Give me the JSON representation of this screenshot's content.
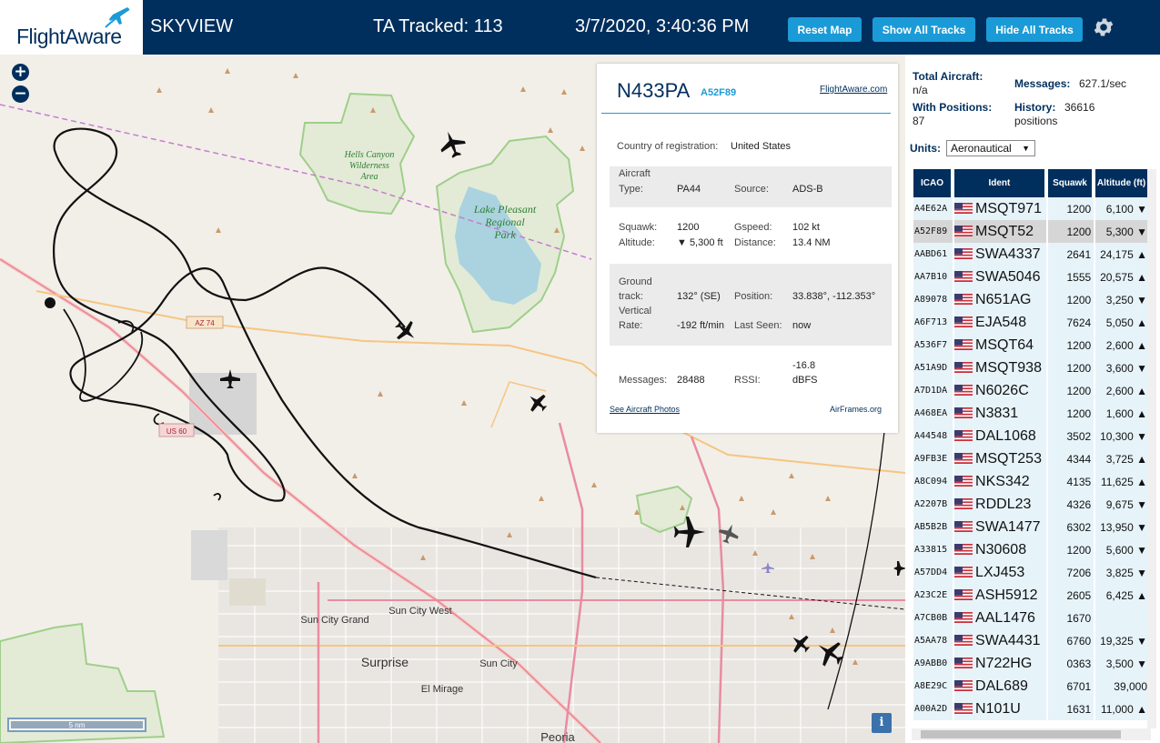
{
  "header": {
    "logo_text": "FlightAware",
    "app_name": "SKYVIEW",
    "ta_tracked": "TA Tracked: 113",
    "datetime": "3/7/2020, 3:40:36 PM",
    "buttons": {
      "reset_map": "Reset Map",
      "show_all_tracks": "Show All Tracks",
      "hide_all_tracks": "Hide All Tracks"
    },
    "settings_icon": "gear-icon"
  },
  "map": {
    "zoom_in": "+",
    "zoom_out": "−",
    "scale_label": "5 nm",
    "info_label": "i",
    "labels": {
      "hells_canyon": [
        "Hells Canyon",
        "Wilderness",
        "Area"
      ],
      "lake_pleasant": [
        "Lake Pleasant",
        "Regional",
        "Park"
      ],
      "sun_city_grand": "Sun City Grand",
      "sun_city_west": "Sun City West",
      "surprise": "Surprise",
      "sun_city": "Sun City",
      "el_mirage": "El Mirage",
      "peoria": "Peoria",
      "hwy_74": "AZ 74",
      "hwy_60": "US 60"
    }
  },
  "popup": {
    "ident": "N433PA",
    "hex": "A52F89",
    "flightaware_link": "FlightAware.com",
    "country_label": "Country of registration:",
    "country_value": "United States",
    "aircraft_type_label_1": "Aircraft",
    "aircraft_type_label_2": "Type:",
    "aircraft_type_value": "PA44",
    "source_label": "Source:",
    "source_value": "ADS-B",
    "squawk_label": "Squawk:",
    "squawk_value": "1200",
    "gspeed_label": "Gspeed:",
    "gspeed_value": "102 kt",
    "altitude_label": "Altitude:",
    "altitude_value": "▼ 5,300 ft",
    "distance_label": "Distance:",
    "distance_value": "13.4 NM",
    "ground_track_label_1": "Ground",
    "ground_track_label_2": "track:",
    "ground_track_value": "132° (SE)",
    "position_label": "Position:",
    "position_value": "33.838°, -112.353°",
    "vertical_rate_label_1": "Vertical",
    "vertical_rate_label_2": "Rate:",
    "vertical_rate_value": "-192 ft/min",
    "last_seen_label": "Last Seen:",
    "last_seen_value": "now",
    "messages_label": "Messages:",
    "messages_value": "28488",
    "rssi_label": "RSSI:",
    "rssi_value_1": "-16.8",
    "rssi_value_2": "dBFS",
    "photos_link": "See Aircraft Photos",
    "airframes_link": "AirFrames.org"
  },
  "sidebar": {
    "total_aircraft_label": "Total Aircraft:",
    "total_aircraft_value": "n/a",
    "messages_label": "Messages:",
    "messages_value": "627.1/sec",
    "with_positions_label": "With Positions:",
    "with_positions_value": "87",
    "history_label": "History:",
    "history_value_1": "36616",
    "history_value_2": "positions",
    "units_label": "Units:",
    "units_value": "Aeronautical",
    "columns": [
      "ICAO",
      "Ident",
      "Squawk",
      "Altitude (ft)"
    ],
    "rows": [
      {
        "icao": "A4E62A",
        "ident": "MSQT971",
        "squawk": "1200",
        "alt": "6,100 ▼",
        "selected": false
      },
      {
        "icao": "A52F89",
        "ident": "MSQT52",
        "squawk": "1200",
        "alt": "5,300 ▼",
        "selected": true
      },
      {
        "icao": "AABD61",
        "ident": "SWA4337",
        "squawk": "2641",
        "alt": "24,175 ▲",
        "selected": false
      },
      {
        "icao": "AA7B10",
        "ident": "SWA5046",
        "squawk": "1555",
        "alt": "20,575 ▲",
        "selected": false
      },
      {
        "icao": "A89078",
        "ident": "N651AG",
        "squawk": "1200",
        "alt": "3,250 ▼",
        "selected": false
      },
      {
        "icao": "A6F713",
        "ident": "EJA548",
        "squawk": "7624",
        "alt": "5,050 ▲",
        "selected": false
      },
      {
        "icao": "A536F7",
        "ident": "MSQT64",
        "squawk": "1200",
        "alt": "2,600 ▲",
        "selected": false
      },
      {
        "icao": "A51A9D",
        "ident": "MSQT938",
        "squawk": "1200",
        "alt": "3,600 ▼",
        "selected": false
      },
      {
        "icao": "A7D1DA",
        "ident": "N6026C",
        "squawk": "1200",
        "alt": "2,600 ▲",
        "selected": false
      },
      {
        "icao": "A468EA",
        "ident": "N3831",
        "squawk": "1200",
        "alt": "1,600 ▲",
        "selected": false
      },
      {
        "icao": "A44548",
        "ident": "DAL1068",
        "squawk": "3502",
        "alt": "10,300 ▼",
        "selected": false
      },
      {
        "icao": "A9FB3E",
        "ident": "MSQT253",
        "squawk": "4344",
        "alt": "3,725 ▲",
        "selected": false
      },
      {
        "icao": "A8C094",
        "ident": "NKS342",
        "squawk": "4135",
        "alt": "11,625 ▲",
        "selected": false
      },
      {
        "icao": "A2207B",
        "ident": "RDDL23",
        "squawk": "4326",
        "alt": "9,675 ▼",
        "selected": false
      },
      {
        "icao": "AB5B2B",
        "ident": "SWA1477",
        "squawk": "6302",
        "alt": "13,950 ▼",
        "selected": false
      },
      {
        "icao": "A33815",
        "ident": "N30608",
        "squawk": "1200",
        "alt": "5,600 ▼",
        "selected": false
      },
      {
        "icao": "A57DD4",
        "ident": "LXJ453",
        "squawk": "7206",
        "alt": "3,825 ▼",
        "selected": false
      },
      {
        "icao": "A23C2E",
        "ident": "ASH5912",
        "squawk": "2605",
        "alt": "6,425 ▲",
        "selected": false
      },
      {
        "icao": "A7CB0B",
        "ident": "AAL1476",
        "squawk": "1670",
        "alt": "",
        "selected": false
      },
      {
        "icao": "A5AA78",
        "ident": "SWA4431",
        "squawk": "6760",
        "alt": "19,325 ▼",
        "selected": false
      },
      {
        "icao": "A9ABB0",
        "ident": "N722HG",
        "squawk": "0363",
        "alt": "3,500 ▼",
        "selected": false
      },
      {
        "icao": "A8E29C",
        "ident": "DAL689",
        "squawk": "6701",
        "alt": "39,000",
        "selected": false
      },
      {
        "icao": "A00A2D",
        "ident": "N101U",
        "squawk": "1631",
        "alt": "11,000 ▲",
        "selected": false
      }
    ]
  },
  "colors": {
    "navy": "#002f5d",
    "accent_blue": "#1a9bd7",
    "map_bg": "#f2efe9",
    "water": "#aad3df",
    "park_border": "#9fcf8a",
    "track": "#111111"
  }
}
